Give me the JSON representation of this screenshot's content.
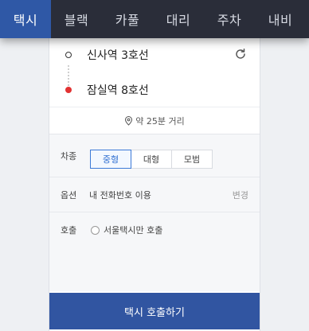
{
  "top_nav": {
    "tabs": [
      {
        "label": "택시",
        "active": true
      },
      {
        "label": "블랙",
        "active": false
      },
      {
        "label": "카풀",
        "active": false
      },
      {
        "label": "대리",
        "active": false
      },
      {
        "label": "주차",
        "active": false
      },
      {
        "label": "내비",
        "active": false
      }
    ]
  },
  "route": {
    "origin": "신사역 3호선",
    "destination": "잠실역 8호선",
    "refresh_icon": "refresh-icon",
    "estimate": "약 25분 거리",
    "estimate_icon": "location-pin-icon"
  },
  "options": {
    "vehicle_type": {
      "label": "차종",
      "choices": [
        "중형",
        "대형",
        "모범"
      ],
      "selected": "중형"
    },
    "option": {
      "label": "옵션",
      "value": "내 전화번호 이용",
      "change": "변경"
    },
    "call": {
      "label": "호출",
      "radio_label": "서울택시만 호출",
      "checked": false
    }
  },
  "call_button": "택시 호출하기",
  "colors": {
    "nav_bg": "#2a2d39",
    "nav_active": "#2f58a6",
    "destination_dot": "#e23232",
    "selected_accent": "#3c7ad8",
    "call_button_bg": "#3155a1"
  }
}
